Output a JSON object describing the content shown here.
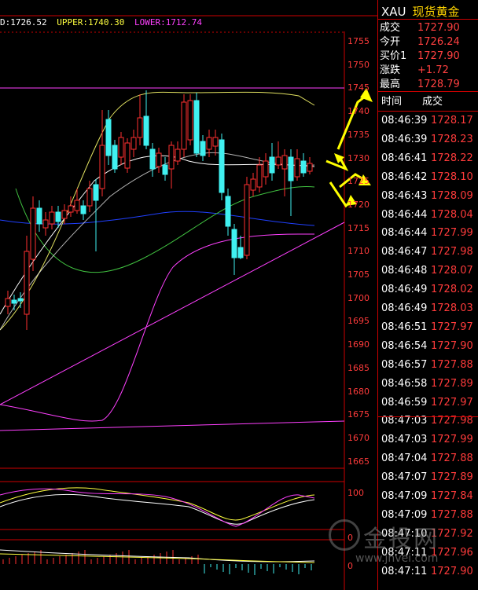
{
  "header": {
    "d_value": "D:1726.52",
    "upper": "UPPER:1740.30",
    "lower": "LOWER:1712.74"
  },
  "price_axis": [
    "1755",
    "1750",
    "1745",
    "1740",
    "1735",
    "1730",
    "1725",
    "1720",
    "1715",
    "1710",
    "1705",
    "1700",
    "1695",
    "1690",
    "1685",
    "1680",
    "1675",
    "1670",
    "1665"
  ],
  "indicator_axis_1": [
    "100",
    "0"
  ],
  "indicator_axis_2": [
    "0"
  ],
  "symbol": {
    "code": "XAU",
    "name": "现货黄金"
  },
  "quote": [
    {
      "k": "成交",
      "v": "1727.90"
    },
    {
      "k": "今开",
      "v": "1726.24"
    },
    {
      "k": "买价1",
      "v": "1727.90"
    },
    {
      "k": "涨跌",
      "v": "+1.72"
    },
    {
      "k": "最高",
      "v": "1728.79"
    }
  ],
  "ticks_header": {
    "time": "时间",
    "price": "成交"
  },
  "ticks": [
    {
      "t": "08:46:39",
      "p": "1728.17"
    },
    {
      "t": "08:46:39",
      "p": "1728.23"
    },
    {
      "t": "08:46:41",
      "p": "1728.22"
    },
    {
      "t": "08:46:42",
      "p": "1728.10"
    },
    {
      "t": "08:46:43",
      "p": "1728.09"
    },
    {
      "t": "08:46:44",
      "p": "1728.04"
    },
    {
      "t": "08:46:44",
      "p": "1727.99"
    },
    {
      "t": "08:46:47",
      "p": "1727.98"
    },
    {
      "t": "08:46:48",
      "p": "1728.07"
    },
    {
      "t": "08:46:49",
      "p": "1728.02"
    },
    {
      "t": "08:46:49",
      "p": "1728.03"
    },
    {
      "t": "08:46:51",
      "p": "1727.97"
    },
    {
      "t": "08:46:54",
      "p": "1727.90"
    },
    {
      "t": "08:46:57",
      "p": "1727.88"
    },
    {
      "t": "08:46:58",
      "p": "1727.89"
    },
    {
      "t": "08:46:59",
      "p": "1727.97"
    },
    {
      "t": "08:47:03",
      "p": "1727.98"
    },
    {
      "t": "08:47:03",
      "p": "1727.99"
    },
    {
      "t": "08:47:04",
      "p": "1727.88"
    },
    {
      "t": "08:47:07",
      "p": "1727.89"
    },
    {
      "t": "08:47:09",
      "p": "1727.84"
    },
    {
      "t": "08:47:09",
      "p": "1727.88"
    },
    {
      "t": "08:47:10",
      "p": "1727.92"
    },
    {
      "t": "08:47:11",
      "p": "1727.96"
    },
    {
      "t": "08:47:11",
      "p": "1727.90"
    }
  ],
  "watermark": {
    "cn": "金投网",
    "url": "www.jnvei.com"
  },
  "colors": {
    "up": "#ff3030",
    "down": "#40f0f0",
    "grid": "#c00000",
    "arrow": "#ffff00"
  }
}
